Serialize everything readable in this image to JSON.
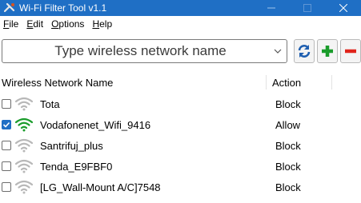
{
  "window": {
    "title": "Wi-Fi Filter Tool v1.1"
  },
  "menu": [
    {
      "u": "F",
      "rest": "ile"
    },
    {
      "u": "E",
      "rest": "dit"
    },
    {
      "u": "O",
      "rest": "ptions"
    },
    {
      "u": "H",
      "rest": "elp"
    }
  ],
  "toolbar": {
    "placeholder": "Type wireless network name"
  },
  "table": {
    "headers": {
      "name": "Wireless Network Name",
      "action": "Action"
    },
    "rows": [
      {
        "checked": false,
        "active": false,
        "name": "Tota",
        "action": "Block"
      },
      {
        "checked": true,
        "active": true,
        "name": "Vodafonenet_Wifi_9416",
        "action": "Allow"
      },
      {
        "checked": false,
        "active": false,
        "name": "Santrifuj_plus",
        "action": "Block"
      },
      {
        "checked": false,
        "active": false,
        "name": "Tenda_E9FBF0",
        "action": "Block"
      },
      {
        "checked": false,
        "active": false,
        "name": "[LG_Wall-Mount A/C]7548",
        "action": "Block"
      }
    ]
  },
  "colors": {
    "titlebar": "#1f6fc5",
    "wifi_active": "#1a9c2b",
    "wifi_inactive": "#b8b8b8",
    "add": "#1a9c2b",
    "remove": "#e0241b"
  }
}
